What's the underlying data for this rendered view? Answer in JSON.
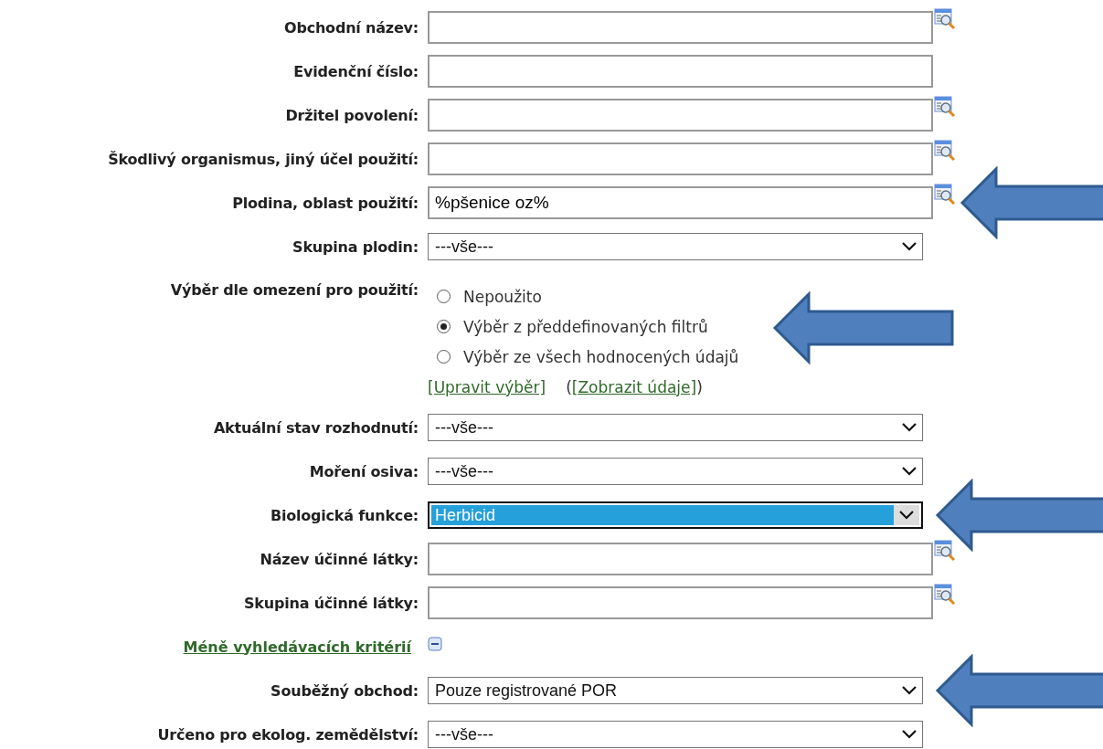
{
  "rows": [
    {
      "kind": "text",
      "label": "Obchodní název:",
      "value": "",
      "lookup": true,
      "arrow": false
    },
    {
      "kind": "text",
      "label": "Evidenční číslo:",
      "value": "",
      "lookup": false,
      "arrow": false
    },
    {
      "kind": "text",
      "label": "Držitel povolení:",
      "value": "",
      "lookup": true,
      "arrow": false
    },
    {
      "kind": "text",
      "label": "Škodlivý organismus, jiný účel použití:",
      "value": "",
      "lookup": true,
      "arrow": false
    },
    {
      "kind": "text",
      "label": "Plodina, oblast použití:",
      "value": "%pšenice oz%",
      "lookup": true,
      "arrow": true
    },
    {
      "kind": "select",
      "label": "Skupina plodin:",
      "value": "---vše---",
      "focused": false,
      "arrow": false
    },
    {
      "kind": "radio",
      "label": "Výběr dle omezení pro použití:",
      "options": [
        {
          "label": "Nepoužito",
          "selected": false,
          "arrow": false
        },
        {
          "label": "Výběr z předdefinovaných filtrů",
          "selected": true,
          "arrow": true
        },
        {
          "label": "Výběr ze všech hodnocených údajů",
          "selected": false,
          "arrow": false
        }
      ],
      "link": "[Upravit výběr]",
      "paren_open": "(",
      "link2": "[Zobrazit údaje]",
      "paren_close": ")"
    },
    {
      "kind": "select",
      "label": "Aktuální stav rozhodnutí:",
      "value": "---vše---",
      "focused": false,
      "arrow": false
    },
    {
      "kind": "select",
      "label": "Moření osiva:",
      "value": "---vše---",
      "focused": false,
      "arrow": false
    },
    {
      "kind": "select",
      "label": "Biologická funkce:",
      "value": "Herbicid",
      "focused": true,
      "arrow": true
    },
    {
      "kind": "text",
      "label": "Název účinné látky:",
      "value": "",
      "lookup": true,
      "arrow": false
    },
    {
      "kind": "text",
      "label": "Skupina účinné látky:",
      "value": "",
      "lookup": true,
      "arrow": false
    },
    {
      "kind": "toggle",
      "label": "Méně vyhledávacích kritérií",
      "expanded": true
    },
    {
      "kind": "select",
      "label": "Souběžný obchod:",
      "value": "Pouze registrované POR",
      "focused": false,
      "arrow": true
    },
    {
      "kind": "select",
      "label": "Určeno pro ekolog. zemědělství:",
      "value": "---vše---",
      "focused": false,
      "arrow": false
    }
  ]
}
